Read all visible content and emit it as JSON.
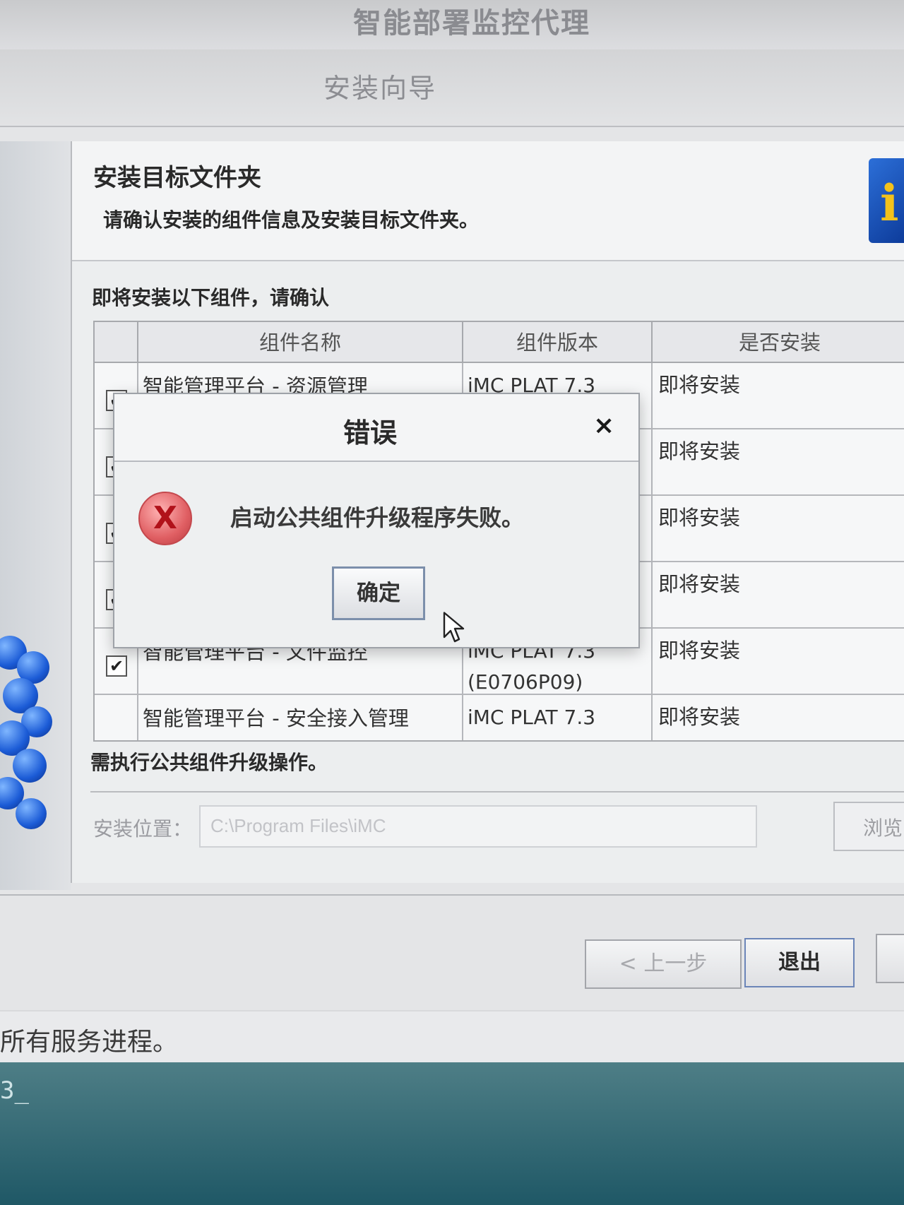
{
  "app": {
    "title": "智能部署监控代理"
  },
  "wizard": {
    "title": "安装向导",
    "section_title": "安装目标文件夹",
    "section_desc": "请确认安装的组件信息及安装目标文件夹。",
    "confirm_label": "即将安装以下组件，请确认",
    "table": {
      "headers": [
        "组件名称",
        "组件版本",
        "是否安装"
      ],
      "rows": [
        {
          "name": "智能管理平台 - 资源管理",
          "version": "iMC PLAT 7.3",
          "version_sub": "",
          "install": "即将安装",
          "checked": true
        },
        {
          "name": "",
          "version": "",
          "version_sub": "",
          "install": "即将安装",
          "checked": true
        },
        {
          "name": "",
          "version": "",
          "version_sub": "",
          "install": "即将安装",
          "checked": true
        },
        {
          "name": "",
          "version": "",
          "version_sub": "",
          "install": "即将安装",
          "checked": true
        },
        {
          "name": "智能管理平台 - 文件监控",
          "version": "iMC PLAT 7.3",
          "version_sub": "(E0706P09)",
          "install": "即将安装",
          "checked": true
        },
        {
          "name": "智能管理平台 - 安全接入管理",
          "version": "iMC PLAT 7.3",
          "version_sub": "",
          "install": "即将安装",
          "checked": false
        }
      ]
    },
    "upgrade_note": "需执行公共组件升级操作。",
    "path_label": "安装位置：",
    "path_value": "C:\\Program Files\\iMC",
    "browse_label": "浏览",
    "buttons": {
      "back": "< 上一步",
      "exit": "退出"
    }
  },
  "status_bar": {
    "text": "所有服务进程。"
  },
  "console": {
    "line": "3_"
  },
  "dialog": {
    "title": "错误",
    "close_glyph": "×",
    "icon_glyph": "X",
    "message": "启动公共组件升级程序失败。",
    "ok_label": "确定"
  },
  "colors": {
    "error_red": "#e05f63",
    "accent_blue": "#1b5bd6",
    "console_teal": "#2f6b77"
  }
}
